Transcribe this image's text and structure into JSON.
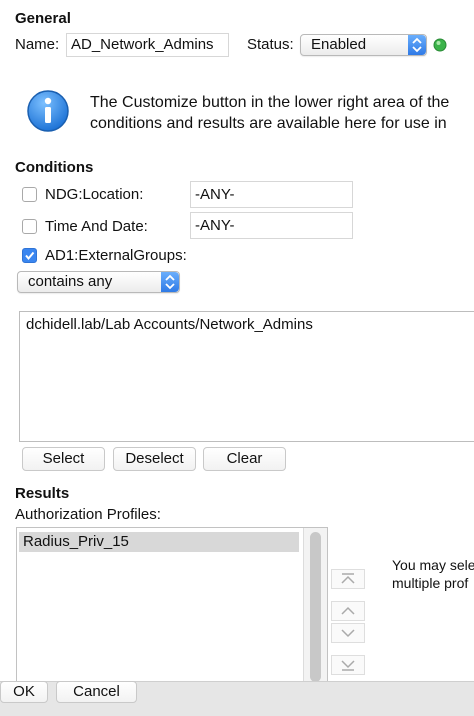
{
  "general": {
    "title": "General",
    "name_label": "Name:",
    "name_value": "AD_Network_Admins",
    "status_label": "Status:",
    "status_value": "Enabled",
    "status_color": "#3bb34a"
  },
  "info": {
    "line1": "The Customize button in the lower right area of the",
    "line2": "conditions and results are available here for use in"
  },
  "conditions": {
    "title": "Conditions",
    "rows": [
      {
        "label": "NDG:Location:",
        "value": "-ANY-",
        "checked": false
      },
      {
        "label": "Time And Date:",
        "value": "-ANY-",
        "checked": false
      },
      {
        "label": "AD1:ExternalGroups:",
        "checked": true
      }
    ],
    "operator": "contains any",
    "groups_value": "dchidell.lab/Lab Accounts/Network_Admins",
    "buttons": {
      "select": "Select",
      "deselect": "Deselect",
      "clear": "Clear"
    }
  },
  "results": {
    "title": "Results",
    "profiles_label": "Authorization Profiles:",
    "profiles": [
      "Radius_Priv_15"
    ],
    "hint_line1": "You may sele",
    "hint_line2": "multiple prof"
  },
  "footer": {
    "ok": "OK",
    "cancel": "Cancel"
  },
  "colors": {
    "accent": "#3a86f0",
    "info_icon": "#1e73d6"
  }
}
